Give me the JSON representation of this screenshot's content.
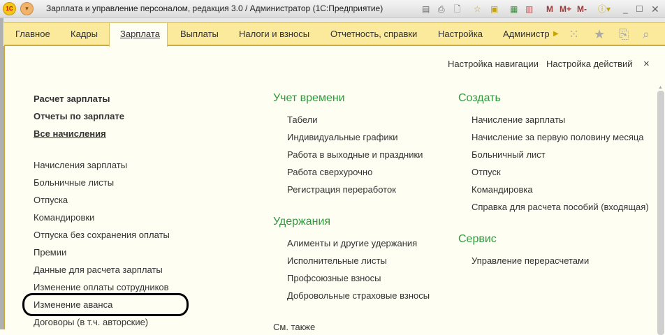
{
  "window": {
    "title": "Зарплата и управление персоналом, редакция 3.0 / Администратор  (1С:Предприятие)",
    "logo": "1С",
    "toolbar_icons": [
      "save-icon",
      "print-icon",
      "preview-icon",
      "add-favorite-icon",
      "favorites-icon",
      "calculator-icon",
      "calendar-icon"
    ],
    "memory_buttons": [
      "M",
      "M+",
      "M-"
    ]
  },
  "nav": {
    "tabs": [
      "Главное",
      "Кадры",
      "Зарплата",
      "Выплаты",
      "Налоги и взносы",
      "Отчетность, справки",
      "Настройка",
      "Администр"
    ],
    "active": "Зарплата"
  },
  "actions": {
    "nav_settings": "Настройка навигации",
    "action_settings": "Настройка действий",
    "close": "×"
  },
  "col1": {
    "bold": [
      "Расчет зарплаты",
      "Отчеты по зарплате",
      "Все начисления"
    ],
    "items": [
      "Начисления зарплаты",
      "Больничные листы",
      "Отпуска",
      "Командировки",
      "Отпуска без сохранения оплаты",
      "Премии",
      "Данные для расчета зарплаты",
      "Изменение оплаты сотрудников",
      "Изменение аванса",
      "Договоры (в т.ч. авторские)"
    ]
  },
  "col2": {
    "time_title": "Учет времени",
    "time_items": [
      "Табели",
      "Индивидуальные графики",
      "Работа в выходные и праздники",
      "Работа сверхурочно",
      "Регистрация переработок"
    ],
    "ded_title": "Удержания",
    "ded_items": [
      "Алименты и другие удержания",
      "Исполнительные листы",
      "Профсоюзные взносы",
      "Добровольные страховые взносы"
    ],
    "see_also": "См. также"
  },
  "col3": {
    "create_title": "Создать",
    "create_items": [
      "Начисление зарплаты",
      "Начисление за первую половину месяца",
      "Больничный лист",
      "Отпуск",
      "Командировка",
      "Справка для расчета пособий (входящая)"
    ],
    "service_title": "Сервис",
    "service_items": [
      "Управление перерасчетами"
    ]
  }
}
